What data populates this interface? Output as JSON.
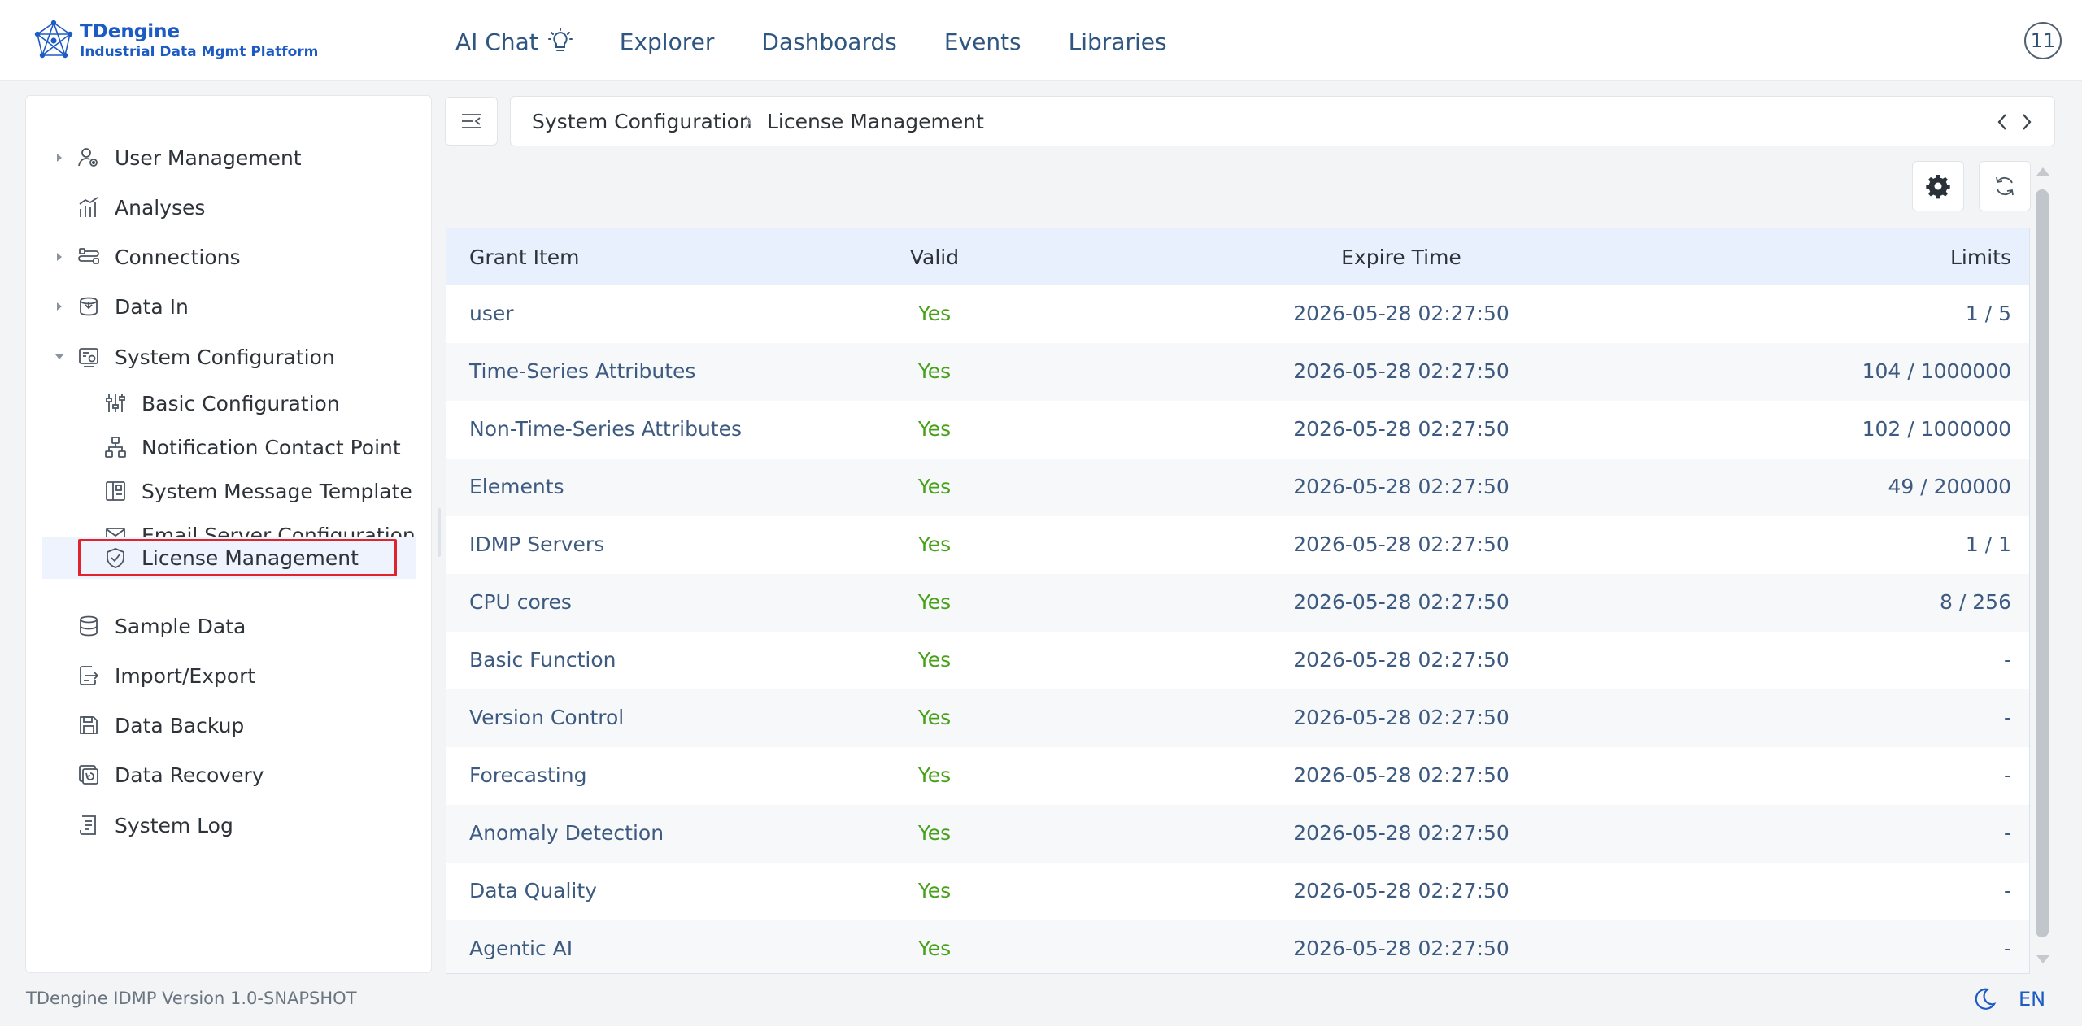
{
  "app": {
    "logo_title": "TDengine",
    "logo_subtitle": "Industrial Data Mgmt Platform",
    "brand_color": "#1d5bc4"
  },
  "nav": {
    "items": [
      {
        "label": "AI Chat",
        "icon": "lightbulb-icon"
      },
      {
        "label": "Explorer"
      },
      {
        "label": "Dashboards"
      },
      {
        "label": "Events"
      },
      {
        "label": "Libraries"
      }
    ],
    "user_badge": "11"
  },
  "sidebar": {
    "items": [
      {
        "label": "User Management",
        "icon": "user-settings-icon",
        "expandable": true,
        "expanded": false
      },
      {
        "label": "Analyses",
        "icon": "analyses-chart-icon",
        "expandable": false
      },
      {
        "label": "Connections",
        "icon": "connections-icon",
        "expandable": true,
        "expanded": false
      },
      {
        "label": "Data In",
        "icon": "data-in-icon",
        "expandable": true,
        "expanded": false
      },
      {
        "label": "System Configuration",
        "icon": "system-config-icon",
        "expandable": true,
        "expanded": true
      },
      {
        "label": "Basic Configuration",
        "icon": "sliders-icon",
        "child": true
      },
      {
        "label": "Notification Contact Point",
        "icon": "network-icon",
        "child": true
      },
      {
        "label": "System Message Template",
        "icon": "template-icon",
        "child": true
      },
      {
        "label": "Email Server Configuration",
        "icon": "mail-icon",
        "child": true
      },
      {
        "label": "License Management",
        "icon": "shield-check-icon",
        "child": true,
        "active": true
      },
      {
        "label": "Sample Data",
        "icon": "database-icon",
        "expandable": false
      },
      {
        "label": "Import/Export",
        "icon": "import-export-icon",
        "expandable": false
      },
      {
        "label": "Data Backup",
        "icon": "backup-icon",
        "expandable": false
      },
      {
        "label": "Data Recovery",
        "icon": "recovery-icon",
        "expandable": false
      },
      {
        "label": "System Log",
        "icon": "log-icon",
        "expandable": false
      }
    ]
  },
  "breadcrumb": {
    "parent": "System Configuration",
    "current": "License Management"
  },
  "table": {
    "headers": {
      "grant_item": "Grant Item",
      "valid": "Valid",
      "expire_time": "Expire Time",
      "limits": "Limits"
    },
    "rows": [
      {
        "item": "user",
        "valid": "Yes",
        "expire": "2026-05-28 02:27:50",
        "limits": "1 / 5"
      },
      {
        "item": "Time-Series Attributes",
        "valid": "Yes",
        "expire": "2026-05-28 02:27:50",
        "limits": "104 / 1000000"
      },
      {
        "item": "Non-Time-Series Attributes",
        "valid": "Yes",
        "expire": "2026-05-28 02:27:50",
        "limits": "102 / 1000000"
      },
      {
        "item": "Elements",
        "valid": "Yes",
        "expire": "2026-05-28 02:27:50",
        "limits": "49 / 200000"
      },
      {
        "item": "IDMP Servers",
        "valid": "Yes",
        "expire": "2026-05-28 02:27:50",
        "limits": "1 / 1"
      },
      {
        "item": "CPU cores",
        "valid": "Yes",
        "expire": "2026-05-28 02:27:50",
        "limits": "8 / 256"
      },
      {
        "item": "Basic Function",
        "valid": "Yes",
        "expire": "2026-05-28 02:27:50",
        "limits": "-"
      },
      {
        "item": "Version Control",
        "valid": "Yes",
        "expire": "2026-05-28 02:27:50",
        "limits": "-"
      },
      {
        "item": "Forecasting",
        "valid": "Yes",
        "expire": "2026-05-28 02:27:50",
        "limits": "-"
      },
      {
        "item": "Anomaly Detection",
        "valid": "Yes",
        "expire": "2026-05-28 02:27:50",
        "limits": "-"
      },
      {
        "item": "Data Quality",
        "valid": "Yes",
        "expire": "2026-05-28 02:27:50",
        "limits": "-"
      },
      {
        "item": "Agentic AI",
        "valid": "Yes",
        "expire": "2026-05-28 02:27:50",
        "limits": "-"
      }
    ],
    "valid_color": "#46a018",
    "header_bg": "#e8f0fe"
  },
  "footer": {
    "version": "TDengine IDMP Version 1.0-SNAPSHOT",
    "language": "EN",
    "theme_icon": "moon-icon"
  }
}
